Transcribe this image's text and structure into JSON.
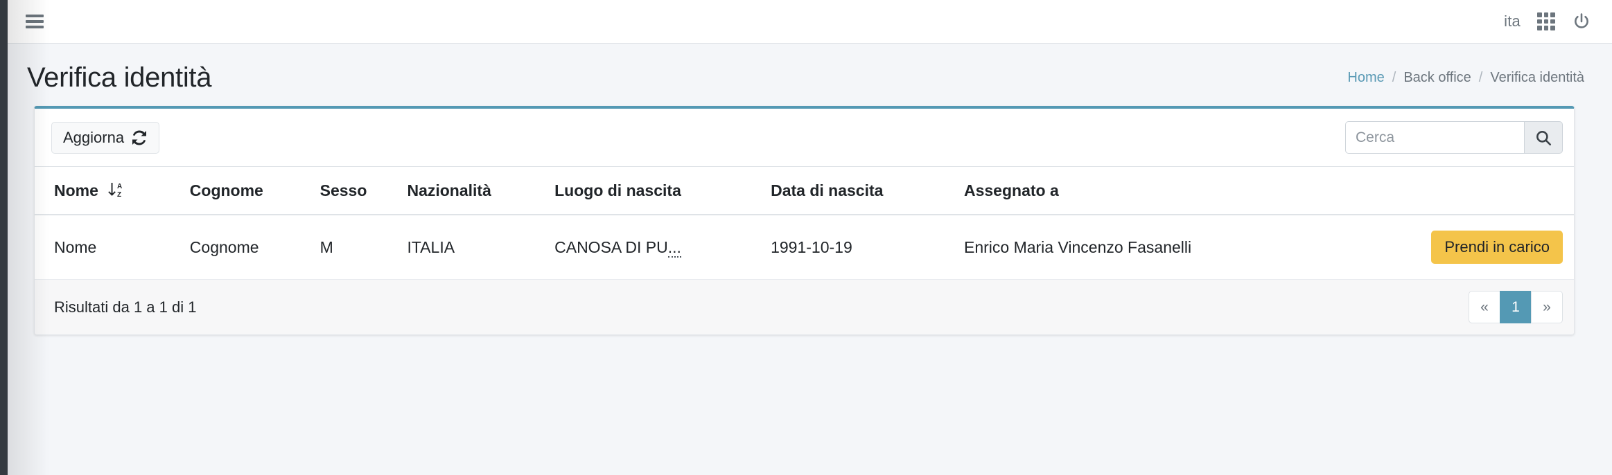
{
  "navbar": {
    "menu_toggle": "hamburger-menu",
    "language": "ita",
    "apps_icon": "grid-icon",
    "power_icon": "power-icon"
  },
  "page": {
    "title": "Verifica identità"
  },
  "breadcrumb": {
    "items": [
      {
        "label": "Home",
        "link": true
      },
      {
        "label": "Back office",
        "link": false
      },
      {
        "label": "Verifica identità",
        "link": false
      }
    ],
    "separator": "/"
  },
  "toolbar": {
    "refresh_label": "Aggiorna",
    "refresh_icon": "sync-icon",
    "search_placeholder": "Cerca",
    "search_value": "",
    "search_icon": "search-icon"
  },
  "table": {
    "columns": [
      {
        "label": "Nome",
        "sortable": true,
        "sort_icon": "sort-alpha-down-icon"
      },
      {
        "label": "Cognome",
        "sortable": false
      },
      {
        "label": "Sesso",
        "sortable": false
      },
      {
        "label": "Nazionalità",
        "sortable": false
      },
      {
        "label": "Luogo di nascita",
        "sortable": false
      },
      {
        "label": "Data di nascita",
        "sortable": false
      },
      {
        "label": "Assegnato a",
        "sortable": false
      },
      {
        "label": "",
        "sortable": false
      }
    ],
    "rows": [
      {
        "nome": "Nome",
        "cognome": "Cognome",
        "sesso": "M",
        "nazionalita": "ITALIA",
        "luogo_di_nascita": "CANOSA DI PU",
        "luogo_truncation": "...",
        "data_di_nascita": "1991-10-19",
        "assegnato_a": "Enrico Maria Vincenzo Fasanelli",
        "action_label": "Prendi in carico"
      }
    ]
  },
  "footer": {
    "results_info": "Risultati da 1 a 1 di 1",
    "pagination": {
      "prev": "«",
      "pages": [
        "1"
      ],
      "active_page": "1",
      "next": "»"
    }
  },
  "colors": {
    "card_accent": "#5499b4",
    "action_button": "#f4c44a",
    "link": "#5a9ab5",
    "page_background": "#f4f6f9",
    "sidebar_rail": "#343a40"
  }
}
